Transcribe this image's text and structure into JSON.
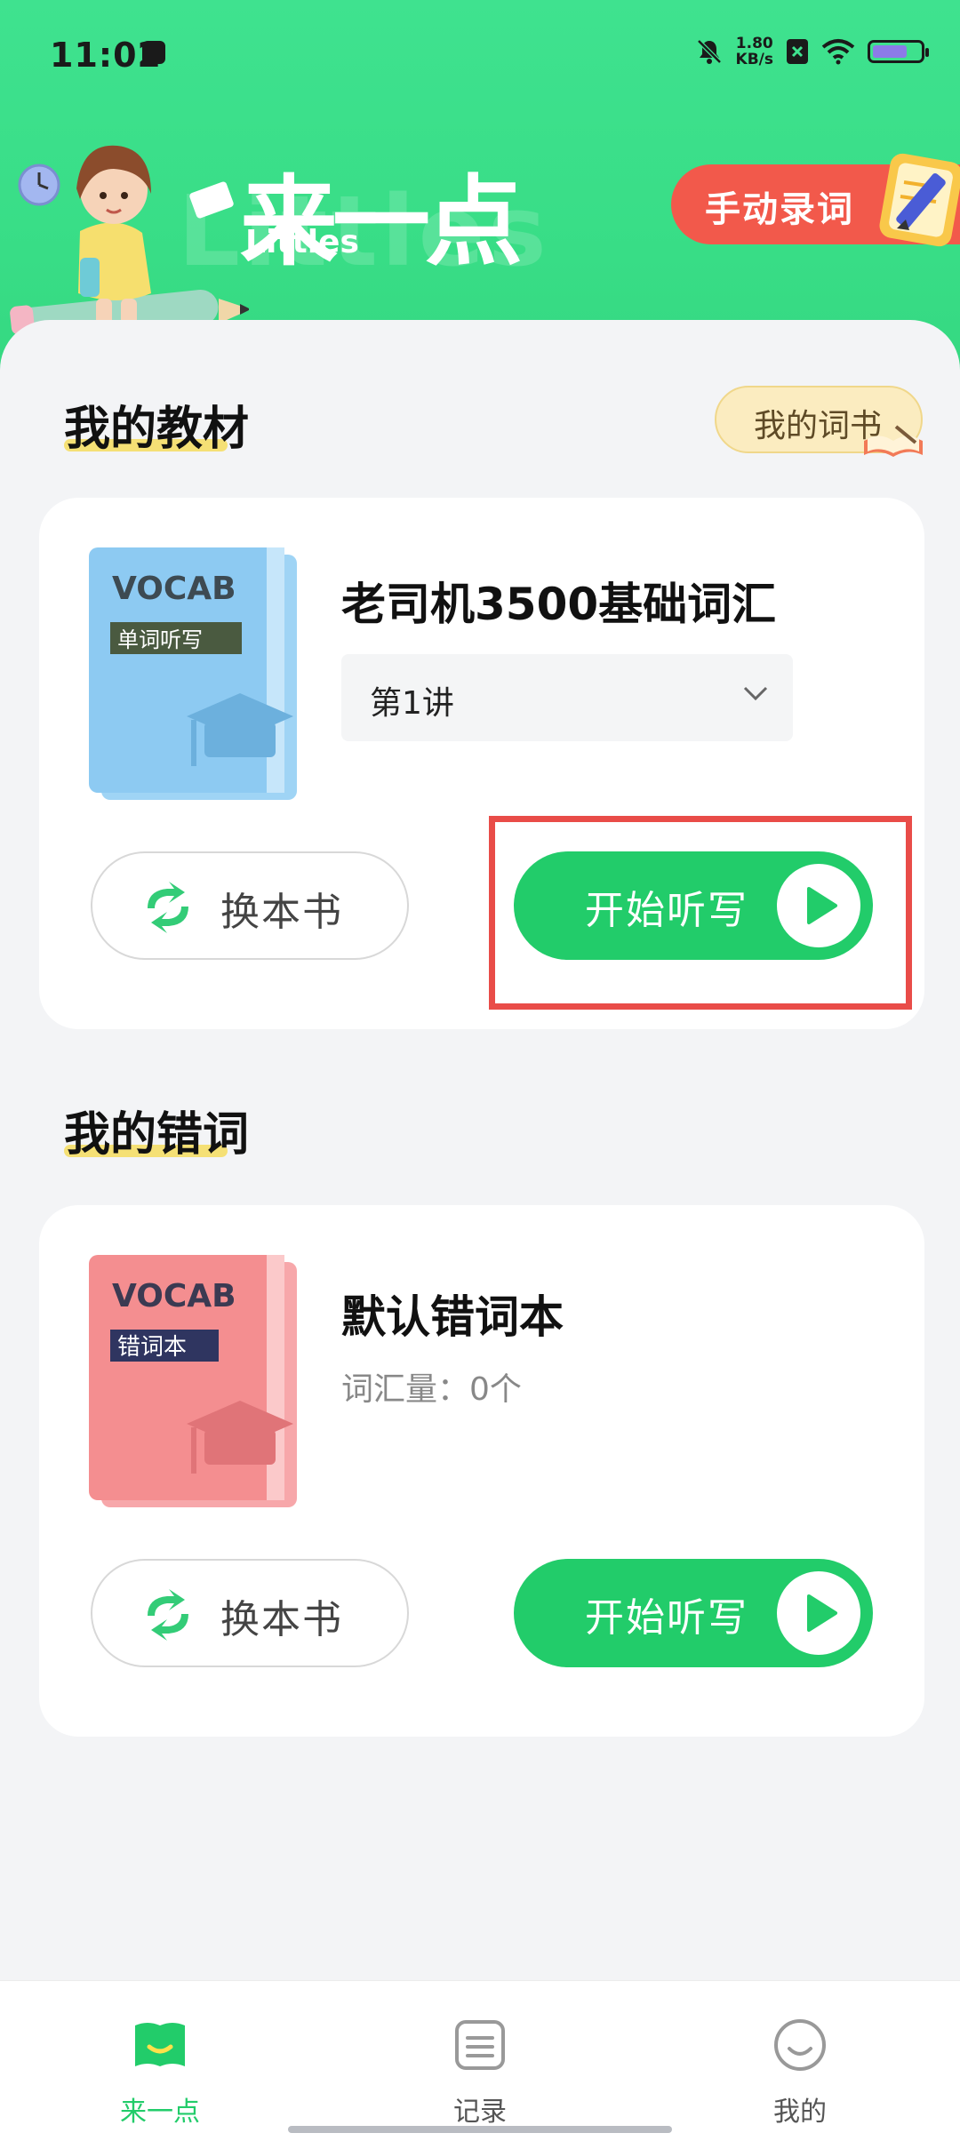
{
  "status_bar": {
    "time": "11:02",
    "network_speed_value": "1.80",
    "network_speed_unit": "KB/s",
    "icons": [
      "notification-icon",
      "mute-icon",
      "no-sim-icon",
      "wifi-icon",
      "battery-icon"
    ]
  },
  "header": {
    "logo_text": "来一点",
    "logo_subtitle": "Littles",
    "manual_entry_label": "手动录词",
    "colors": {
      "primary": "#3fe28f",
      "accent_red": "#f2594b"
    }
  },
  "my_textbook": {
    "section_title": "我的教材",
    "wordbook_button": "我的词书",
    "book_cover_title": "VOCAB",
    "book_cover_subtitle": "单词听写",
    "book_name": "老司机3500基础词汇",
    "selected_lecture": "第1讲",
    "swap_button": "换本书",
    "start_button": "开始听写"
  },
  "my_mistakes": {
    "section_title": "我的错词",
    "book_cover_title": "VOCAB",
    "book_cover_subtitle": "错词本",
    "book_name": "默认错词本",
    "vocab_count": "词汇量：0个",
    "swap_button": "换本书",
    "start_button": "开始听写"
  },
  "bottom_nav": {
    "items": [
      {
        "label": "来一点",
        "icon": "book-icon",
        "active": true
      },
      {
        "label": "记录",
        "icon": "record-icon",
        "active": false
      },
      {
        "label": "我的",
        "icon": "profile-icon",
        "active": false
      }
    ],
    "active_color": "#22cc6a"
  }
}
